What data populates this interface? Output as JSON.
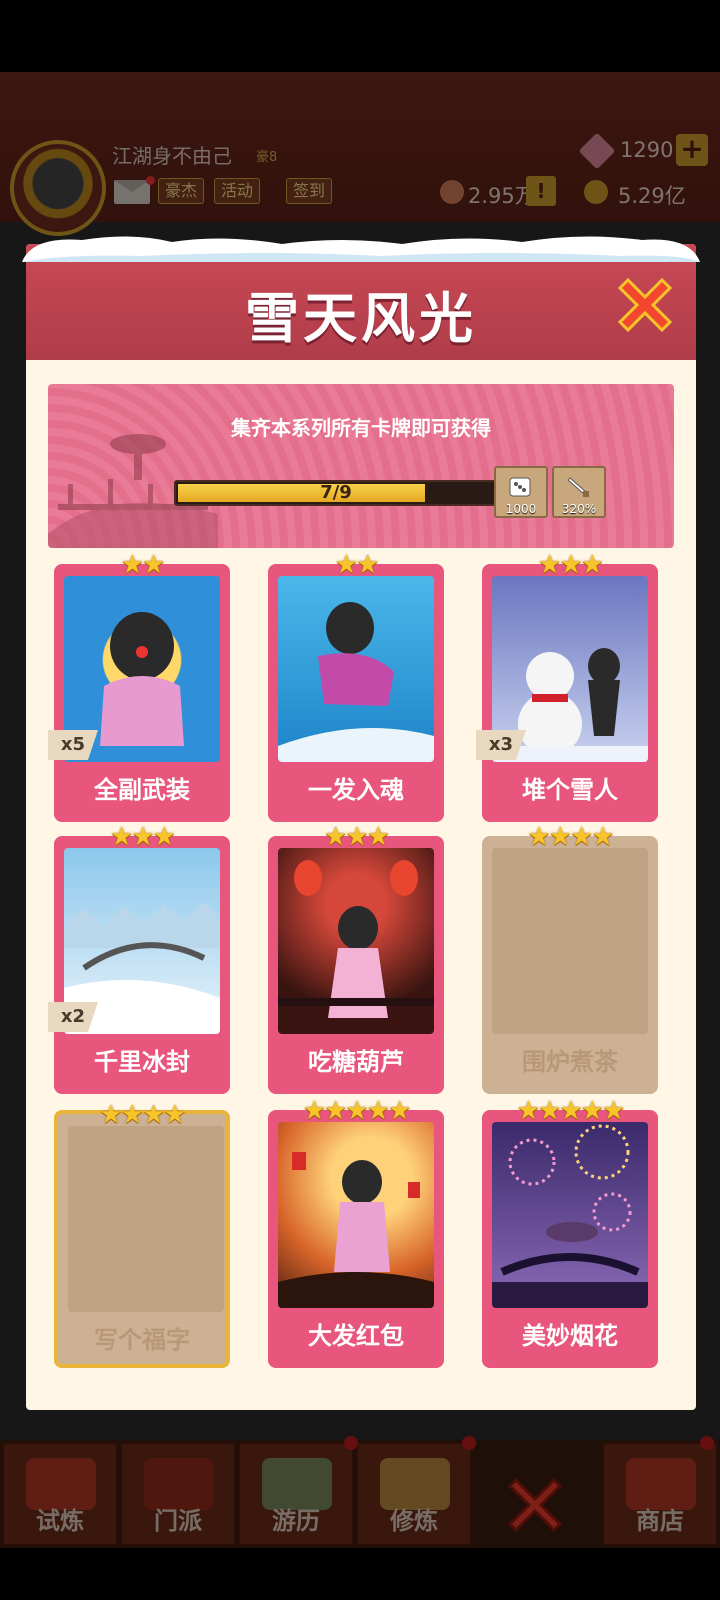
{
  "player": {
    "name": "江湖身不由己",
    "rank": "豪8",
    "buttons": [
      "豪杰",
      "活动",
      "签到"
    ],
    "gems": "1290",
    "honor": "2.95万",
    "gold": "5.29亿"
  },
  "modal": {
    "title": "雪天风光",
    "banner_text": "集齐本系列所有卡牌即可获得",
    "progress": {
      "current": 7,
      "total": 9,
      "label": "7/9"
    },
    "rewards": [
      {
        "icon": "dice-icon",
        "value": "1000"
      },
      {
        "icon": "sword-icon",
        "value": "320%"
      }
    ],
    "cards": [
      {
        "name": "全副武装",
        "stars": "★★",
        "count": "x5",
        "owned": true
      },
      {
        "name": "一发入魂",
        "stars": "★★",
        "count": "",
        "owned": true
      },
      {
        "name": "堆个雪人",
        "stars": "★★★",
        "count": "x3",
        "owned": true
      },
      {
        "name": "千里冰封",
        "stars": "★★★",
        "count": "x2",
        "owned": true
      },
      {
        "name": "吃糖葫芦",
        "stars": "★★★",
        "count": "",
        "owned": true
      },
      {
        "name": "围炉煮茶",
        "stars": "★★★★",
        "count": "",
        "owned": false
      },
      {
        "name": "写个福字",
        "stars": "★★★★",
        "count": "",
        "owned": false
      },
      {
        "name": "大发红包",
        "stars": "★★★★★",
        "count": "",
        "owned": true
      },
      {
        "name": "美妙烟花",
        "stars": "★★★★★",
        "count": "",
        "owned": true
      }
    ]
  },
  "nav": [
    "试炼",
    "门派",
    "游历",
    "修炼",
    "商店"
  ],
  "colors": {
    "accent": "#e8567d",
    "header": "#b03c49",
    "gold": "#f7c52a"
  }
}
